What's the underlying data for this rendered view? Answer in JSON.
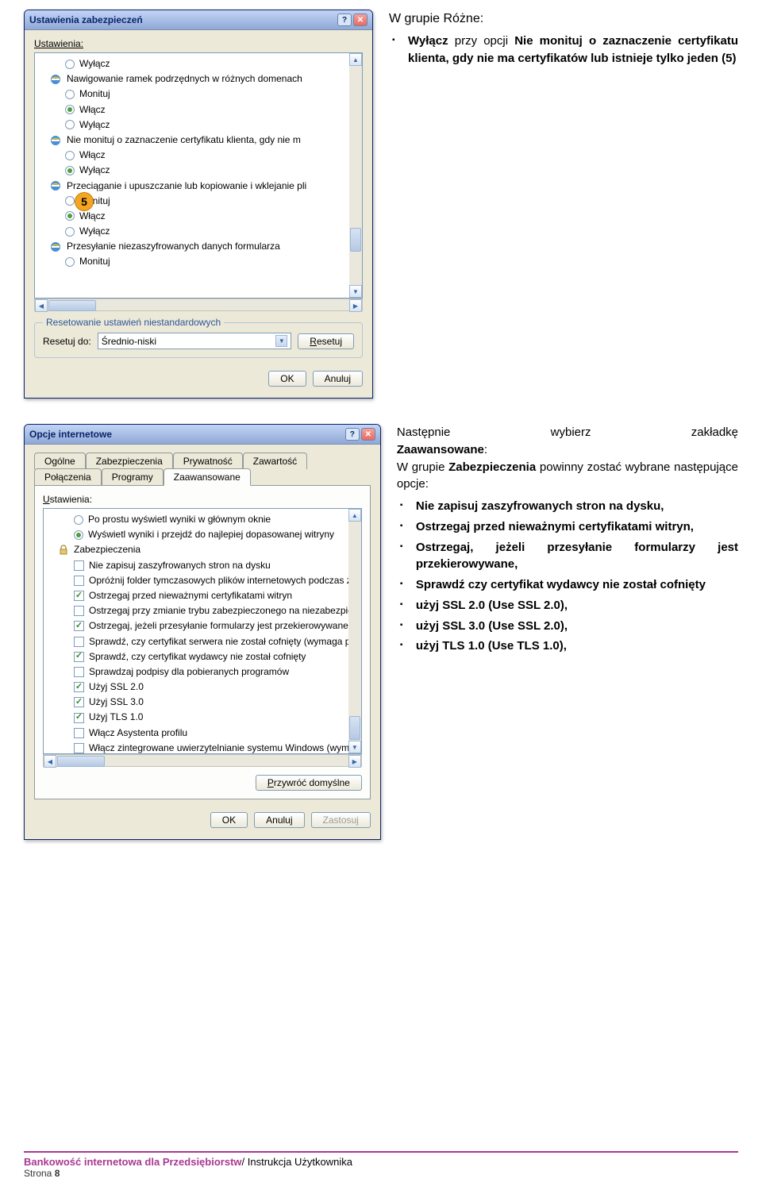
{
  "section1": {
    "heading": "W grupie Różne:",
    "bullet_pre": "Wyłącz",
    "bullet_mid": " przy opcji ",
    "bullet_bold": "Nie monituj o zaznaczenie certyfikatu klienta, gdy nie ma certyfikatów lub istnieje tylko jeden (5)"
  },
  "section2": {
    "line1_a": "Następnie",
    "line1_b": "wybierz",
    "line1_c": "zakładkę",
    "line1_bold": "Zaawansowane",
    "line2_a": "W grupie ",
    "line2_b": "Zabezpieczenia",
    "line2_c": " powinny zostać wybrane następujące opcje:",
    "bullets": [
      {
        "bold": "Nie zapisuj zaszyfrowanych stron na dysku,"
      },
      {
        "pre": "Ostrzegaj",
        "mid": " przed nieważnymi ",
        "post": "certyfikatami witryn,",
        "boldparts": [
          "Ostrzegaj",
          "certyfikatami witryn,"
        ]
      },
      {
        "text": "Ostrzegaj, jeżeli przesyłanie formularzy jest przekierowywane,"
      },
      {
        "text": "Sprawdź czy certyfikat wydawcy nie został cofnięty"
      },
      {
        "text": "użyj SSL 2.0 (Use SSL 2.0),"
      },
      {
        "text": "użyj SSL 3.0 (Use SSL 2.0),"
      },
      {
        "text": "użyj TLS 1.0 (Use TLS 1.0),"
      }
    ]
  },
  "dialog1": {
    "title": "Ustawienia zabezpieczeń",
    "settings_label": "Ustawienia:",
    "items": [
      {
        "type": "radio",
        "sel": false,
        "label": "Wyłącz",
        "sub": true
      },
      {
        "type": "hdr",
        "label": "Nawigowanie ramek podrzędnych w różnych domenach"
      },
      {
        "type": "radio",
        "sel": false,
        "label": "Monituj",
        "sub": true
      },
      {
        "type": "radio",
        "sel": true,
        "label": "Włącz",
        "sub": true
      },
      {
        "type": "radio",
        "sel": false,
        "label": "Wyłącz",
        "sub": true
      },
      {
        "type": "hdr",
        "label": "Nie monituj o zaznaczenie certyfikatu klienta, gdy nie m"
      },
      {
        "type": "radio",
        "sel": false,
        "label": "Włącz",
        "sub": true
      },
      {
        "type": "radio",
        "sel": true,
        "label": "Wyłącz",
        "sub": true,
        "badge": true
      },
      {
        "type": "hdr",
        "label": "Przeciąganie i upuszczanie lub kopiowanie i wklejanie pli"
      },
      {
        "type": "radio",
        "sel": false,
        "label": "Monituj",
        "sub": true
      },
      {
        "type": "radio",
        "sel": true,
        "label": "Włącz",
        "sub": true
      },
      {
        "type": "radio",
        "sel": false,
        "label": "Wyłącz",
        "sub": true
      },
      {
        "type": "hdr",
        "label": "Przesyłanie niezaszyfrowanych danych formularza"
      },
      {
        "type": "radio",
        "sel": false,
        "label": "Monituj",
        "sub": true,
        "cut": true
      }
    ],
    "reset_legend": "Resetowanie ustawień niestandardowych",
    "reset_label": "Resetuj do:",
    "reset_value": "Średnio-niski",
    "reset_btn": "Resetuj",
    "ok": "OK",
    "cancel": "Anuluj",
    "badge": "5"
  },
  "dialog2": {
    "title": "Opcje internetowe",
    "tabs_row1": [
      "Ogólne",
      "Zabezpieczenia",
      "Prywatność",
      "Zawartość"
    ],
    "tabs_row2": [
      "Połączenia",
      "Programy",
      "Zaawansowane"
    ],
    "settings_label": "Ustawienia:",
    "items": [
      {
        "type": "radio",
        "sel": false,
        "label": "Po prostu wyświetl wyniki w głównym oknie",
        "sub": true
      },
      {
        "type": "radio",
        "sel": true,
        "label": "Wyświetl wyniki i przejdź do najlepiej dopasowanej witryny",
        "sub": true
      },
      {
        "type": "lockhdr",
        "label": "Zabezpieczenia"
      },
      {
        "type": "chk",
        "sel": false,
        "label": "Nie zapisuj zaszyfrowanych stron na dysku",
        "sub": true
      },
      {
        "type": "chk",
        "sel": false,
        "label": "Opróżnij folder tymczasowych plików internetowych podczas z",
        "sub": true
      },
      {
        "type": "chk",
        "sel": true,
        "label": "Ostrzegaj przed nieważnymi certyfikatami witryn",
        "sub": true
      },
      {
        "type": "chk",
        "sel": false,
        "label": "Ostrzegaj przy zmianie trybu zabezpieczonego na niezabezpiec",
        "sub": true
      },
      {
        "type": "chk",
        "sel": true,
        "label": "Ostrzegaj, jeżeli przesyłanie formularzy jest przekierowywane",
        "sub": true
      },
      {
        "type": "chk",
        "sel": false,
        "label": "Sprawdź, czy certyfikat serwera nie został cofnięty (wymaga p",
        "sub": true
      },
      {
        "type": "chk",
        "sel": true,
        "label": "Sprawdź, czy certyfikat wydawcy nie został cofnięty",
        "sub": true
      },
      {
        "type": "chk",
        "sel": false,
        "label": "Sprawdzaj podpisy dla pobieranych programów",
        "sub": true
      },
      {
        "type": "chk",
        "sel": true,
        "label": "Użyj SSL 2.0",
        "sub": true
      },
      {
        "type": "chk",
        "sel": true,
        "label": "Użyj SSL 3.0",
        "sub": true
      },
      {
        "type": "chk",
        "sel": true,
        "label": "Użyj TLS 1.0",
        "sub": true
      },
      {
        "type": "chk",
        "sel": false,
        "label": "Włącz Asystenta profilu",
        "sub": true
      },
      {
        "type": "chk",
        "sel": false,
        "label": "Włącz zintegrowane uwierzytelnianie systemu Windows (wyma",
        "sub": true
      }
    ],
    "restore": "Przywróć domyślne",
    "ok": "OK",
    "cancel": "Anuluj",
    "apply": "Zastosuj"
  },
  "footer": {
    "title": "Bankowość internetowa dla Przedsiębiorstw",
    "suffix": "/ Instrukcja Użytkownika",
    "page": "Strona 8"
  }
}
